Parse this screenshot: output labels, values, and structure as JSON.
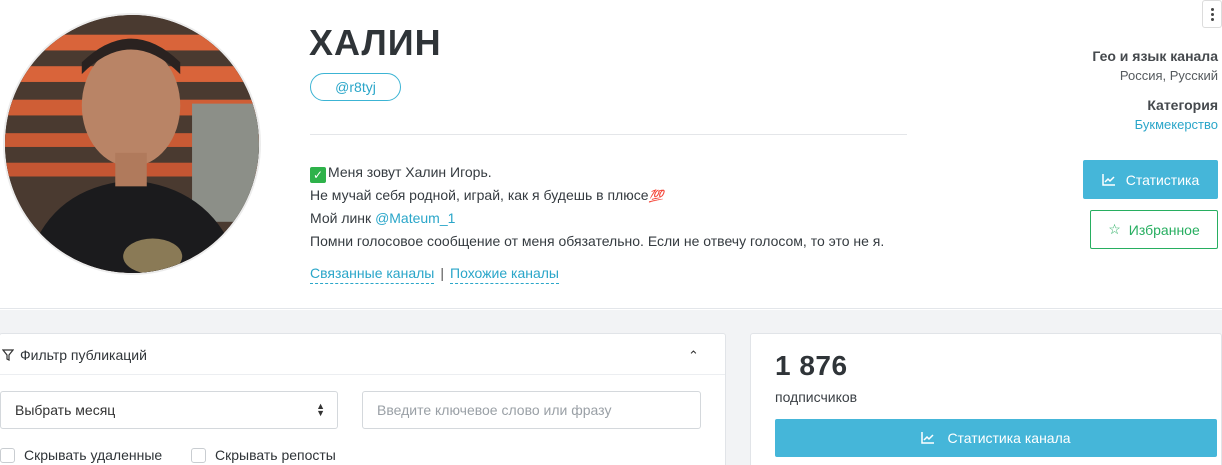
{
  "channel": {
    "title": "ХАЛИН",
    "handle": "@r8tyj",
    "description": {
      "line1": "Меня зовут Халин Игорь.",
      "line2": "Не мучай себя родной, играй, как я будешь в плюсе",
      "line3_prefix": "Мой линк ",
      "line3_mention": "@Mateum_1",
      "line4": "Помни голосовое сообщение от меня обязательно. Если не отвечу голосом, то это не я."
    },
    "links": {
      "related": "Связанные каналы",
      "separator": "|",
      "similar": "Похожие каналы"
    }
  },
  "side": {
    "geo_label": "Гео и язык канала",
    "geo_value": "Россия, Русский",
    "category_label": "Категория",
    "category_value": "Букмекерство",
    "stats_button": "Статистика",
    "favorite_button": "Избранное"
  },
  "filter": {
    "title": "Фильтр публикаций",
    "month_select": "Выбрать месяц",
    "keyword_placeholder": "Введите ключевое слово или фразу",
    "hide_deleted": "Скрывать удаленные",
    "hide_reposts": "Скрывать репосты"
  },
  "subscribers": {
    "count": "1 876",
    "label": "подписчиков",
    "channel_stats_button": "Статистика канала"
  },
  "colors": {
    "accent": "#45b6d9",
    "link": "#2aa6c9",
    "favorite": "#27ae60"
  },
  "icons": {
    "check": "white-check-mark-icon",
    "hundred": "hundred-points-icon",
    "chart": "chart-line-icon",
    "star": "star-outline-icon",
    "filter": "funnel-icon",
    "collapse": "chevron-up-icon",
    "menu": "vertical-dots-icon"
  }
}
